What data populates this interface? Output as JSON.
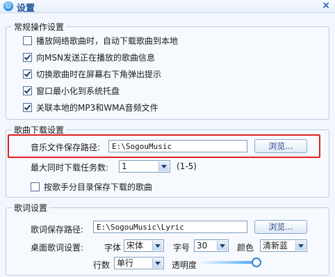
{
  "window": {
    "title": "设置",
    "close": "×"
  },
  "general": {
    "legend": "常规操作设置",
    "options": [
      {
        "label": "播放网络歌曲时，自动下载歌曲到本地",
        "checked": false
      },
      {
        "label": "向MSN发送正在播放的歌曲信息",
        "checked": true
      },
      {
        "label": "切换歌曲时在屏幕右下角弹出提示",
        "checked": true
      },
      {
        "label": "窗口最小化到系统托盘",
        "checked": true
      },
      {
        "label": "关联本地的MP3和WMA音频文件",
        "checked": true
      }
    ]
  },
  "download": {
    "legend": "歌曲下载设置",
    "path_label": "音乐文件保存路径:",
    "path_value": "E:\\SogouMusic",
    "browse_label": "浏览...",
    "max_tasks_label": "最大同时下载任务数:",
    "max_tasks_value": "1",
    "max_tasks_range": "(1-5)",
    "by_singer": {
      "label": "按歌手分目录保存下载的歌曲",
      "checked": false
    }
  },
  "lyrics": {
    "legend": "歌词设置",
    "path_label": "歌词保存路径:",
    "path_value": "E:\\SogouMusic\\Lyric",
    "browse_label": "浏览...",
    "desktop_label": "桌面歌词设置:",
    "font_label": "字体",
    "font_value": "宋体",
    "size_label": "字号",
    "size_value": "30",
    "color_label": "颜色",
    "color_value": "清新蓝",
    "lines_label": "行数",
    "lines_value": "单行",
    "opacity_label": "透明度",
    "opacity": 0.9
  }
}
